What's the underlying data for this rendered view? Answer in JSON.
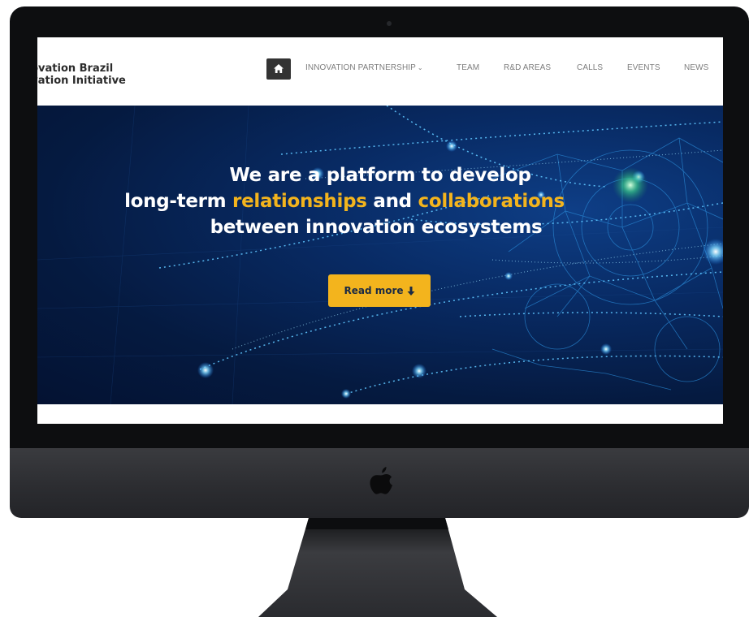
{
  "site": {
    "logo_line1": "Inovation Brazil",
    "logo_line2": "Innovation Initiative"
  },
  "nav": {
    "home_icon": "home-icon",
    "items": [
      {
        "label": "INNOVATION PARTNERSHIP",
        "has_dropdown": true
      },
      {
        "label": "TEAM"
      },
      {
        "label": "R&D AREAS"
      },
      {
        "label": "CALLS"
      },
      {
        "label": "EVENTS"
      },
      {
        "label": "NEWS"
      }
    ],
    "caret": "⌄"
  },
  "hero": {
    "line1": "We are a platform to develop",
    "line2_a": "long-term ",
    "line2_hl1": "relationships",
    "line2_b": " and ",
    "line2_hl2": "collaborations",
    "line3": "between innovation ecosystems",
    "button_label": "Read more",
    "button_icon": "arrow-down-icon"
  },
  "colors": {
    "accent": "#f3b41d",
    "hero_bg": "#082a63",
    "bezel": "#0d0e10",
    "chin": "#2c2d31"
  }
}
